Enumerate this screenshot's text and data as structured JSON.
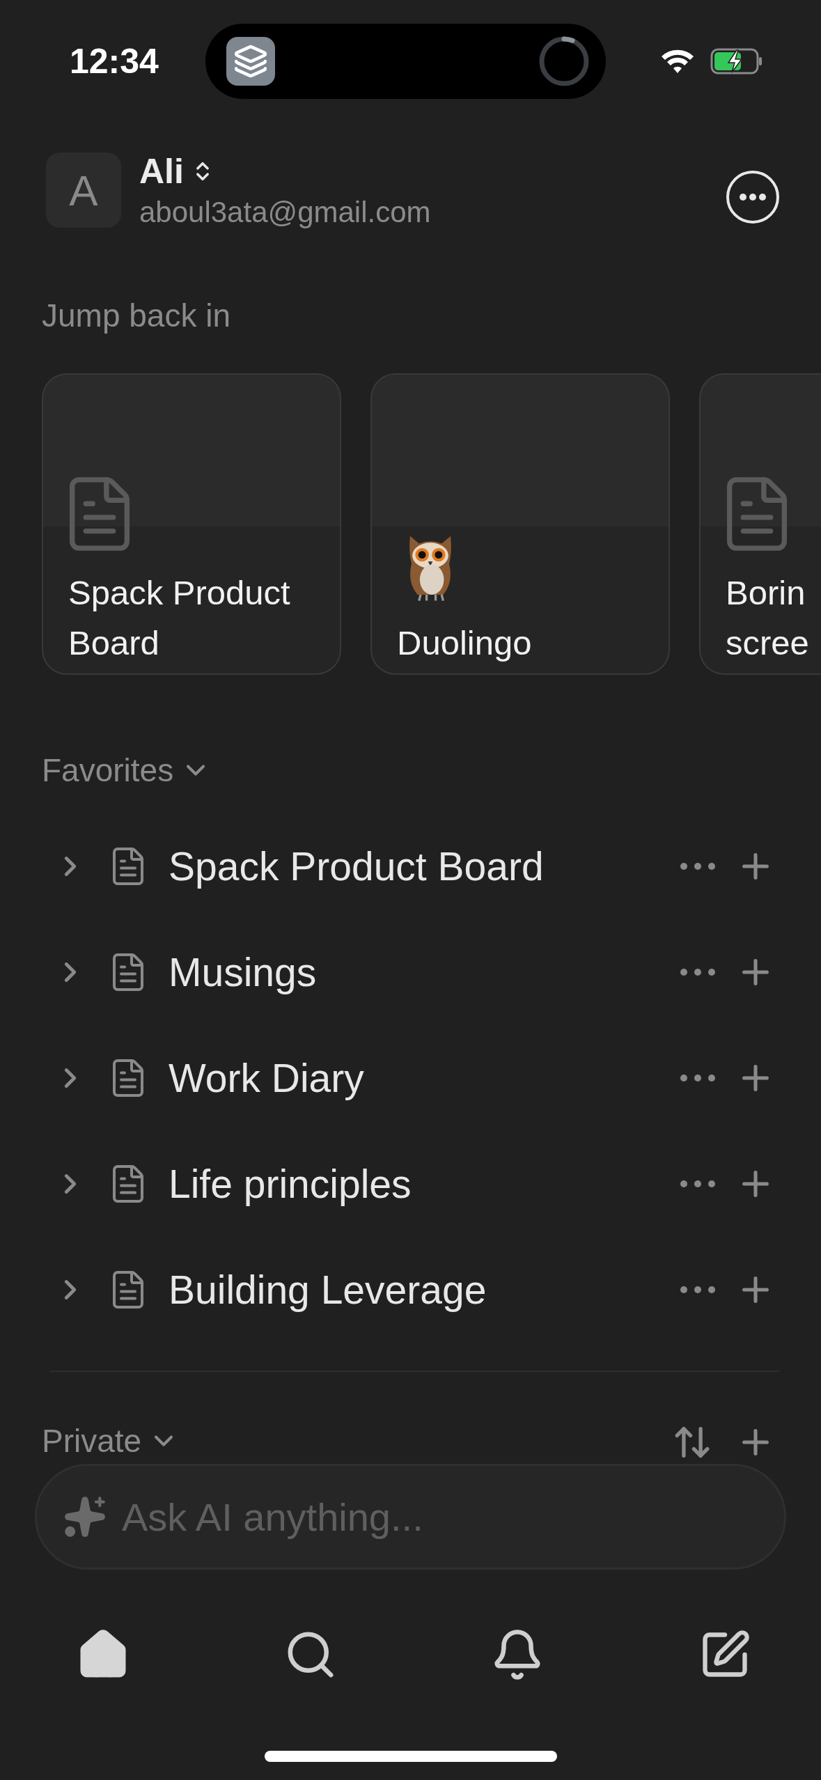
{
  "status_bar": {
    "time": "12:34"
  },
  "account": {
    "avatar_letter": "A",
    "name": "Ali",
    "email": "aboul3ata@gmail.com"
  },
  "jump_back_in": {
    "title": "Jump back in",
    "cards": [
      {
        "kind": "page",
        "title": "Spack Product Board"
      },
      {
        "kind": "emoji",
        "title": "Duolingo"
      },
      {
        "kind": "page",
        "title": "Borin\nscree"
      }
    ]
  },
  "favorites": {
    "title": "Favorites",
    "items": [
      {
        "label": "Spack Product Board"
      },
      {
        "label": "Musings"
      },
      {
        "label": "Work Diary"
      },
      {
        "label": "Life principles"
      },
      {
        "label": "Building Leverage"
      }
    ]
  },
  "private": {
    "title": "Private"
  },
  "ask_ai": {
    "placeholder": "Ask AI anything..."
  },
  "tab_bar": [
    {
      "kind": "home",
      "selected": true
    },
    {
      "kind": "search",
      "selected": false
    },
    {
      "kind": "notifications",
      "selected": false
    },
    {
      "kind": "compose",
      "selected": false
    }
  ]
}
